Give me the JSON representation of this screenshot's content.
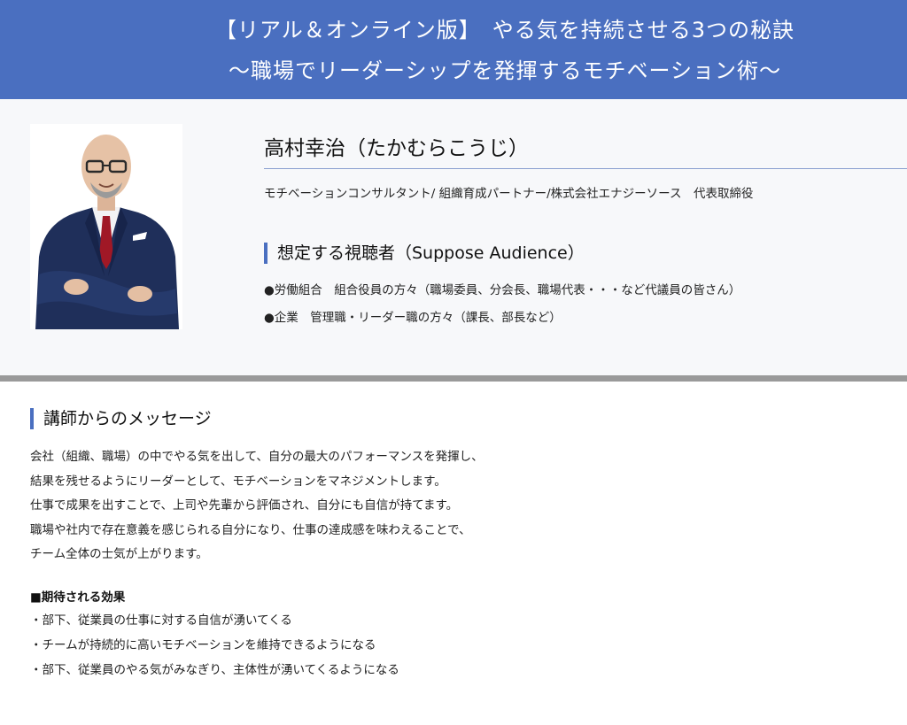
{
  "banner": {
    "line1": "【リアル＆オンライン版】　やる気を持続させる3つの秘訣",
    "line2": "〜職場でリーダーシップを発揮するモチベーション術〜"
  },
  "profile": {
    "name": "高村幸治（たかむらこうじ）",
    "title": "モチベーションコンサルタント/ 組織育成パートナー/株式会社エナジーソース　代表取締役",
    "audience_heading": "想定する視聴者（Suppose Audience）",
    "audience": [
      "●労働組合　組合役員の方々（職場委員、分会長、職場代表・・・など代議員の皆さん）",
      "●企業　管理職・リーダー職の方々（課長、部長など）"
    ]
  },
  "message": {
    "heading": "講師からのメッセージ",
    "paragraphs": [
      "会社（組織、職場）の中でやる気を出して、自分の最大のパフォーマンスを発揮し、",
      "結果を残せるようにリーダーとして、モチベーションをマネジメントします。",
      "仕事で成果を出すことで、上司や先輩から評価され、自分にも自信が持てます。",
      "職場や社内で存在意義を感じられる自分になり、仕事の達成感を味わえることで、",
      "チーム全体の士気が上がります。"
    ],
    "effects_heading": "■期待される効果",
    "effects": [
      "・部下、従業員の仕事に対する自信が湧いてくる",
      "・チームが持続的に高いモチベーションを維持できるようになる",
      "・部下、従業員のやる気がみなぎり、主体性が湧いてくるようになる"
    ]
  },
  "colors": {
    "banner": "#4a6fc0",
    "accent": "#4a6fc0",
    "divider": "#9a9a9a",
    "suit": "#1f2f5a",
    "tie": "#a01826"
  }
}
